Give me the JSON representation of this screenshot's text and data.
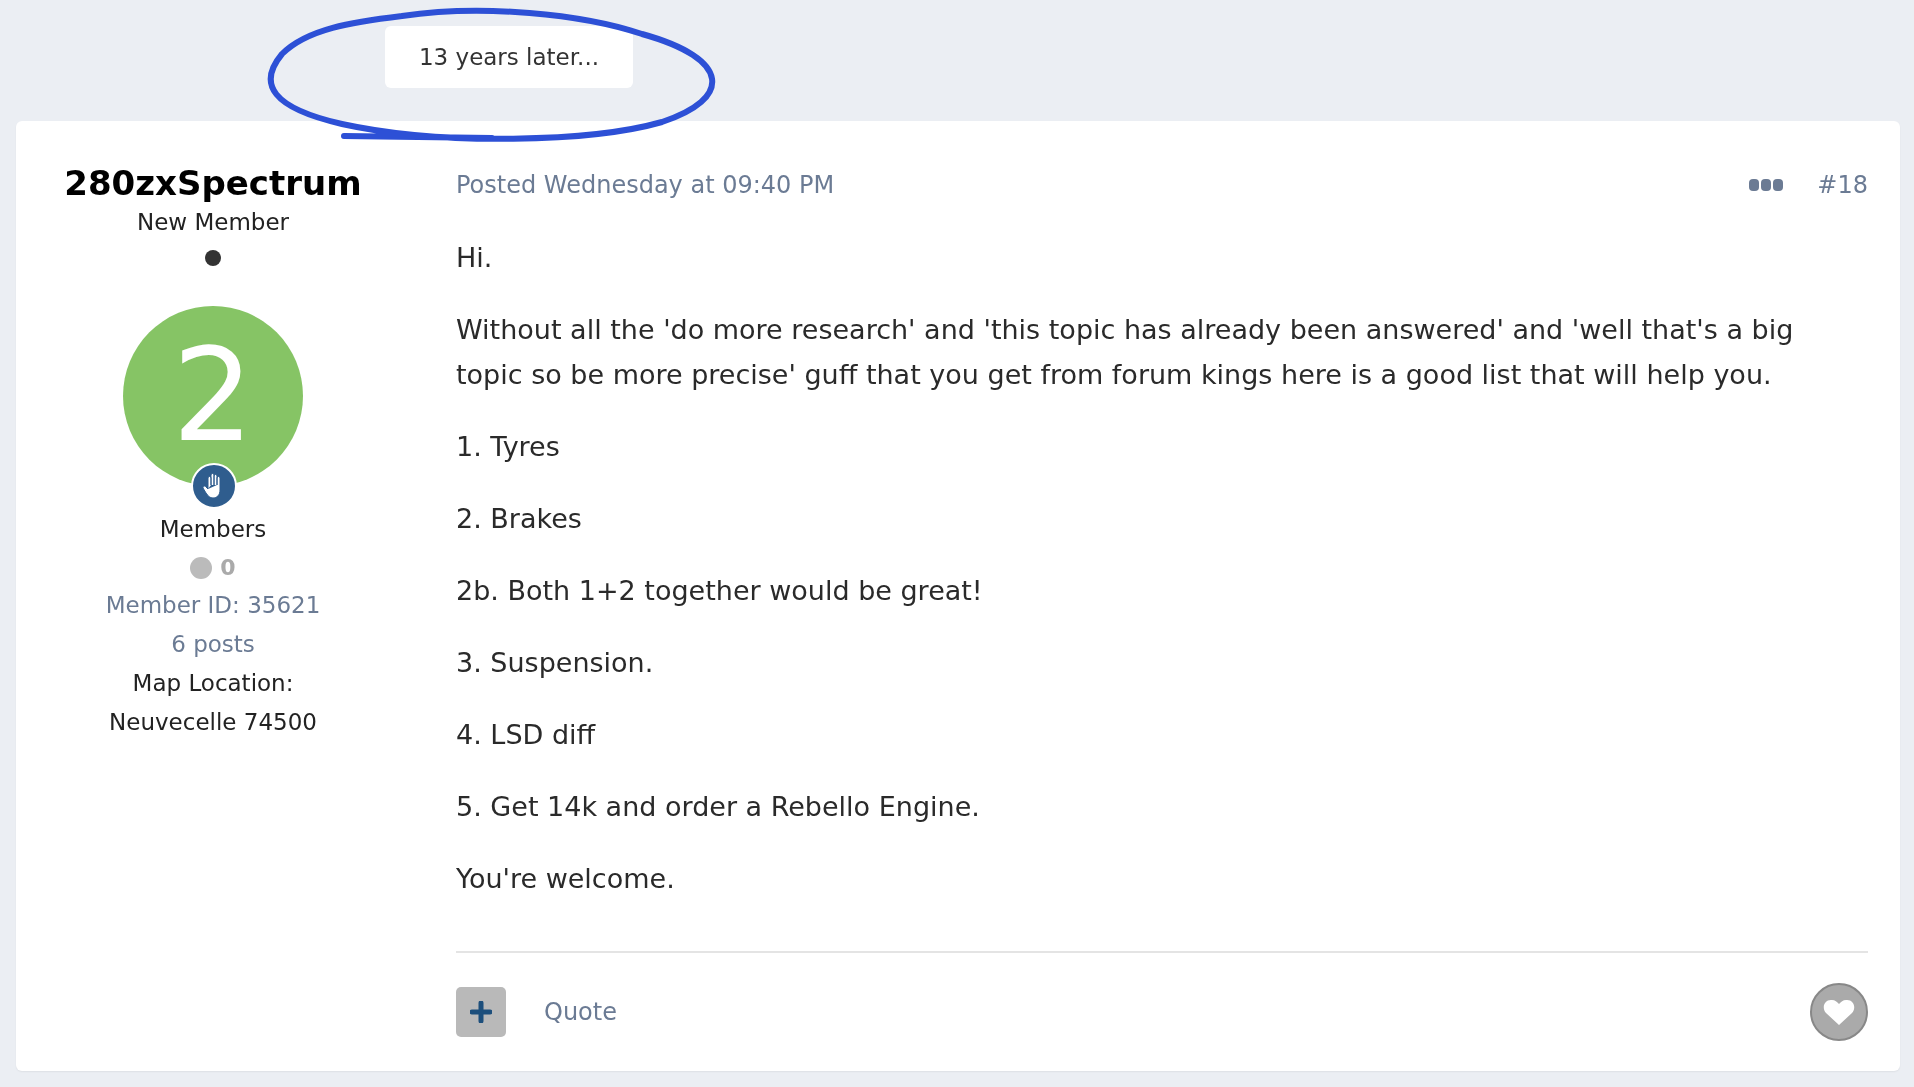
{
  "separator": {
    "text": "13 years later..."
  },
  "author": {
    "name": "280zxSpectrum",
    "title": "New Member",
    "online": false,
    "avatar_letter": "2",
    "group": "Members",
    "reputation": "0",
    "member_id": "Member ID: 35621",
    "posts": "6 posts",
    "location_label": "Map Location:",
    "location": "Neuvecelle 74500"
  },
  "post": {
    "posted": "Posted Wednesday at 09:40 PM",
    "number": "#18",
    "paragraphs": [
      "Hi.",
      "Without all the 'do more research' and 'this topic has already been answered' and 'well that's a big topic so be more precise' guff that you get from forum kings here is a good list that will help you.",
      "1. Tyres",
      "2. Brakes",
      "2b. Both 1+2 together would be great!",
      "3. Suspension.",
      "4. LSD diff",
      "5. Get 14k and order a Rebello Engine.",
      "You're welcome."
    ],
    "quote": "Quote",
    "liked": false
  }
}
